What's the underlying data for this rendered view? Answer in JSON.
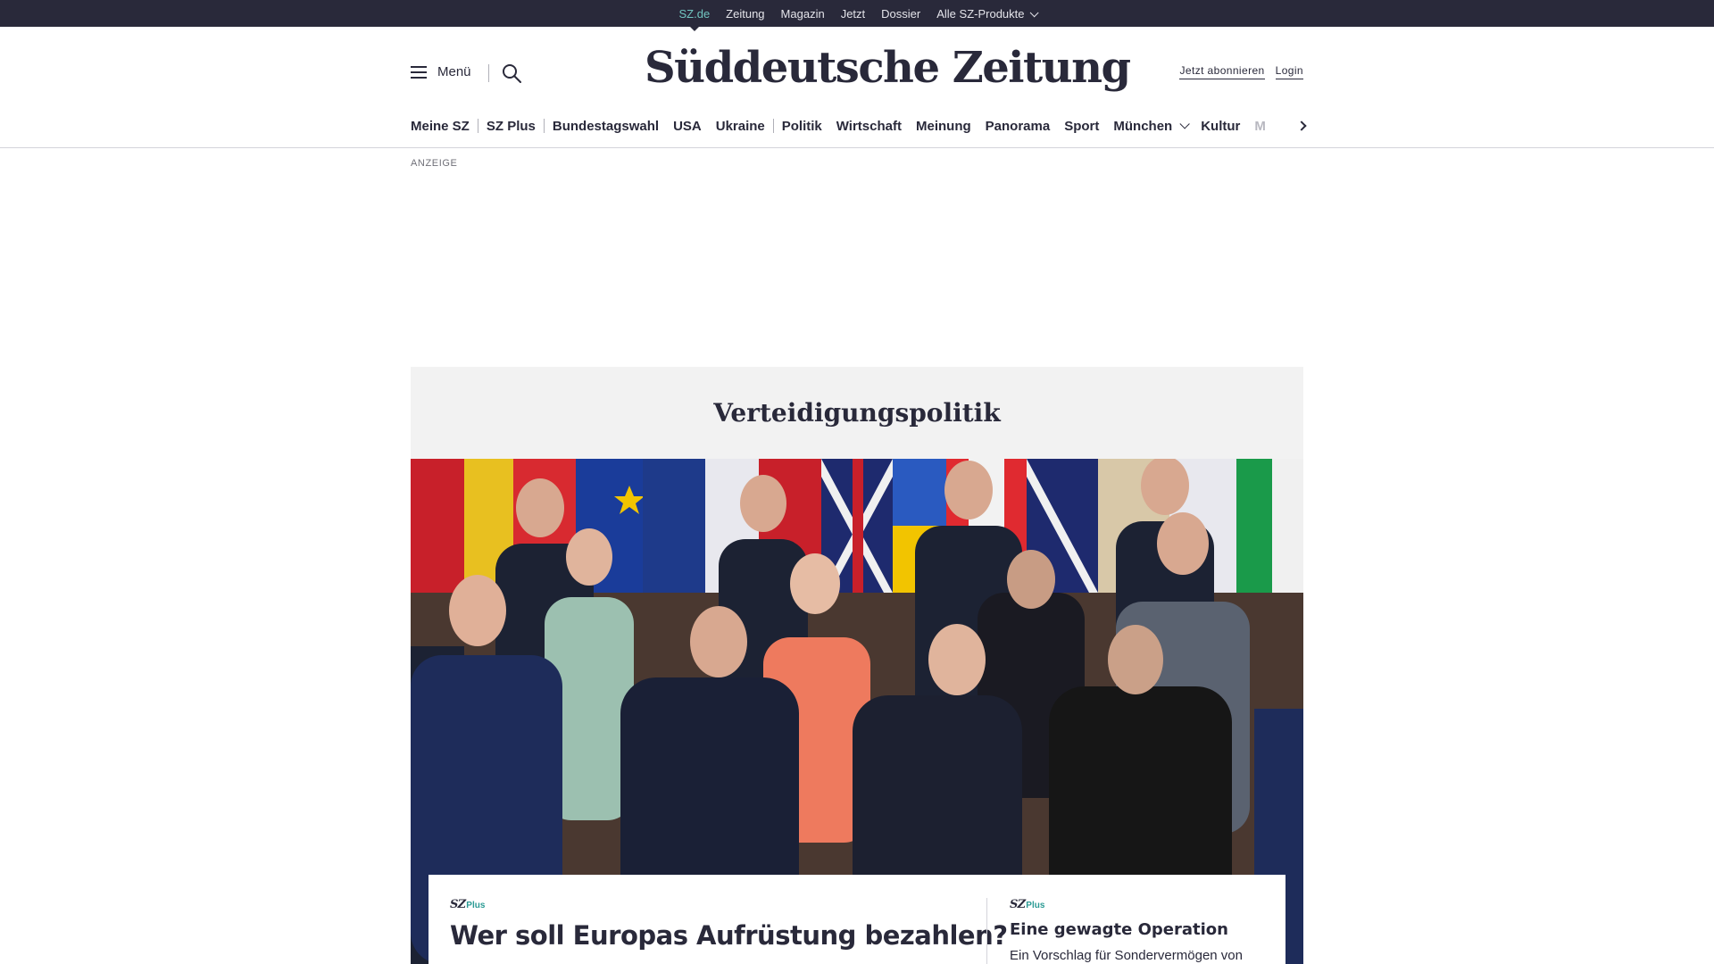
{
  "colors": {
    "topbar_bg": "#29293a",
    "accent_teal": "#71c5c0",
    "text_primary": "#29293a",
    "section_bg": "#f2f2f2",
    "szplus_green": "#2a9a94"
  },
  "topbar": {
    "links": [
      "SZ.de",
      "Zeitung",
      "Magazin",
      "Jetzt",
      "Dossier",
      "Alle SZ-Produkte"
    ]
  },
  "header": {
    "menu_label": "Menü",
    "menu_icon": "hamburger-icon",
    "search_icon": "search-icon",
    "logo": "Süddeutsche Zeitung",
    "subscribe_label": "Jetzt abonnieren",
    "login_label": "Login"
  },
  "nav": {
    "items": [
      "Meine SZ",
      "SZ Plus",
      "Bundestagswahl",
      "USA",
      "Ukraine",
      "Politik",
      "Wirtschaft",
      "Meinung",
      "Panorama",
      "Sport",
      "München",
      "Kultur",
      "M"
    ],
    "next_icon": "chevron-right-icon"
  },
  "ad": {
    "label": "ANZEIGE"
  },
  "section": {
    "title": "Verteidigungspolitik"
  },
  "teaser_main": {
    "badge_sz": "SZ",
    "badge_plus": "Plus",
    "headline": "Wer soll Europas Aufrüstung bezahlen?"
  },
  "teaser_side": {
    "badge_sz": "SZ",
    "badge_plus": "Plus",
    "headline": "Eine gewagte Operation",
    "text": "Ein Vorschlag für Sondervermögen von"
  }
}
